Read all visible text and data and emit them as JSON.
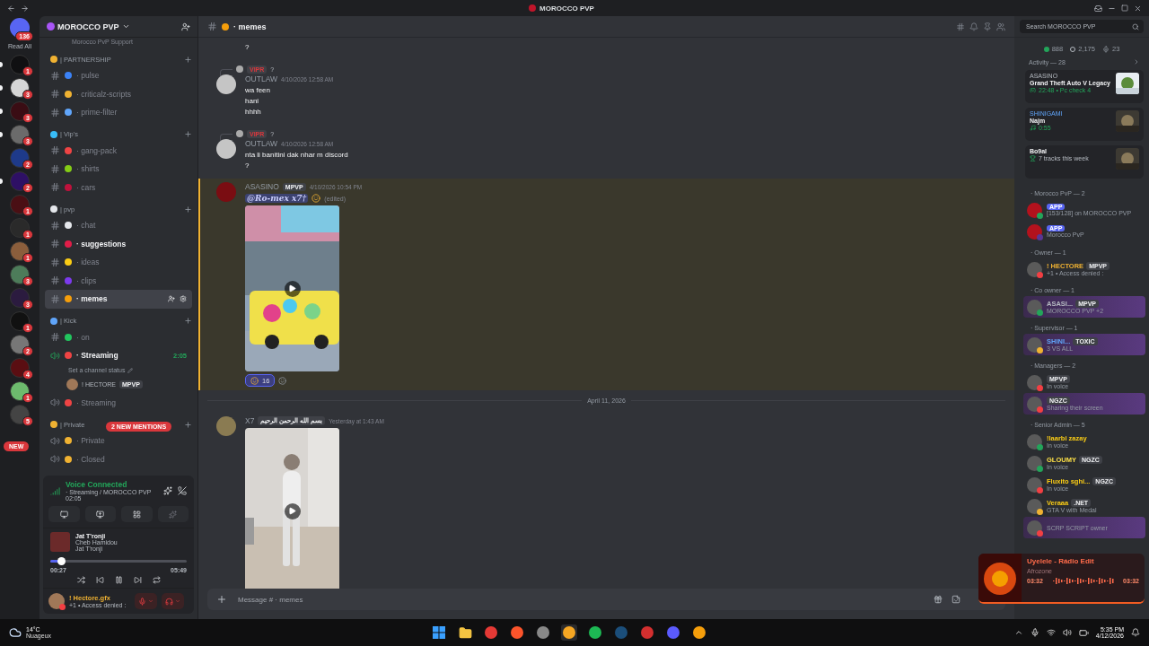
{
  "window": {
    "title": "MOROCCO PVP"
  },
  "rail": {
    "home_badge": "136",
    "read_all": "Read All",
    "new_pill": "NEW",
    "servers": [
      {
        "badge": "1",
        "unread": true
      },
      {
        "badge": "3",
        "unread": true
      },
      {
        "badge": "3",
        "unread": true
      },
      {
        "badge": "3",
        "unread": true
      },
      {
        "badge": "2",
        "unread": false
      },
      {
        "badge": "2",
        "unread": true
      },
      {
        "badge": "1",
        "unread": false
      },
      {
        "badge": "1",
        "unread": false
      },
      {
        "badge": "1",
        "unread": false
      },
      {
        "badge": "3",
        "unread": false
      },
      {
        "badge": "3",
        "unread": false
      },
      {
        "badge": "1",
        "unread": false
      },
      {
        "badge": "2",
        "unread": false
      },
      {
        "badge": "4",
        "unread": false
      },
      {
        "badge": "1",
        "unread": false
      },
      {
        "badge": "5",
        "unread": false
      }
    ]
  },
  "server": {
    "name": "MOROCCO PVP",
    "partial_item": "Morocco PvP Support",
    "mentions_pill": "2 NEW MENTIONS"
  },
  "categories": [
    {
      "name": "| PARTNERSHIP",
      "color": "#f0b232",
      "channels": [
        {
          "kind": "text",
          "name": "· pulse",
          "color": "#3b82f6",
          "selected": false,
          "unread": false
        },
        {
          "kind": "text",
          "name": "· criticalz-scripts",
          "color": "#f0b232",
          "selected": false,
          "unread": false
        },
        {
          "kind": "text",
          "name": "· prime-filter",
          "color": "#60a5fa",
          "selected": false,
          "unread": false
        }
      ]
    },
    {
      "name": "| Vip's",
      "color": "#38bdf8",
      "channels": [
        {
          "kind": "text",
          "name": "· gang-pack",
          "color": "#ef4444",
          "selected": false,
          "unread": false
        },
        {
          "kind": "text",
          "name": "· shirts",
          "color": "#84cc16",
          "selected": false,
          "unread": false
        },
        {
          "kind": "text",
          "name": "· cars",
          "color": "#be123c",
          "selected": false,
          "unread": false
        }
      ]
    },
    {
      "name": "| pvp",
      "color": "#e5e7eb",
      "channels": [
        {
          "kind": "text",
          "name": "· chat",
          "color": "#e5e7eb",
          "selected": false,
          "unread": false
        },
        {
          "kind": "text",
          "name": "· suggestions",
          "color": "#e11d48",
          "selected": false,
          "unread": true
        },
        {
          "kind": "text",
          "name": "· ideas",
          "color": "#facc15",
          "selected": false,
          "unread": false
        },
        {
          "kind": "text",
          "name": "· clips",
          "color": "#7c3aed",
          "selected": false,
          "unread": false
        },
        {
          "kind": "text",
          "name": "· memes",
          "color": "#f59e0b",
          "selected": true,
          "unread": false
        }
      ]
    },
    {
      "name": "| Kick",
      "color": "#60a5fa",
      "channels": [
        {
          "kind": "text",
          "name": "· on",
          "color": "#22c55e",
          "selected": false,
          "unread": false
        },
        {
          "kind": "voice",
          "name": "· Streaming",
          "color": "#ef4444",
          "selected": false,
          "unread": false,
          "active": true,
          "timer": "2:05",
          "status": "Set a channel status",
          "users": [
            {
              "name": "! HECTORE",
              "tag": "MPVP"
            }
          ]
        },
        {
          "kind": "voice",
          "name": "· Streaming",
          "color": "#ef4444",
          "selected": false,
          "unread": false,
          "active": false
        }
      ]
    },
    {
      "name": "| Private",
      "color": "#f0b232",
      "channels": [
        {
          "kind": "voice",
          "name": "· Private",
          "color": "#f0b232",
          "selected": false,
          "unread": false,
          "active": false
        },
        {
          "kind": "voice",
          "name": "· Closed",
          "color": "#f0b232",
          "selected": false,
          "unread": false,
          "active": false
        }
      ]
    }
  ],
  "voice": {
    "title": "Voice Connected",
    "channel": "· Streaming / MOROCCO PVP",
    "elapsed": "02:05"
  },
  "music": {
    "title": "Jat T'ronji",
    "artist": "Cheb Hamidou",
    "album": "Jat T'ronji",
    "level": 0.08,
    "position": "00:27",
    "duration": "05:49",
    "playing": true
  },
  "user": {
    "name": "! Hectore.gfx",
    "status": "+1 • Access denied :",
    "muted": true,
    "deafened": true
  },
  "channel": {
    "name": "· memes",
    "placeholder": "Search MOROCCO PVP"
  },
  "messages": [
    {
      "kind": "tail",
      "lines": [
        "?"
      ]
    },
    {
      "kind": "message",
      "reply": {
        "tag": "VIPR",
        "text": "?"
      },
      "author": "OUTLAW",
      "time": "4/10/2026 12:58 AM",
      "lines": [
        "wa feen",
        "hani",
        "hhhh"
      ],
      "highlighted": false
    },
    {
      "kind": "message",
      "reply": {
        "tag": "VIPR",
        "text": "?"
      },
      "author": "OUTLAW",
      "time": "4/10/2026 12:58 AM",
      "lines": [
        "nta li banitini dak nhar m discord",
        "?"
      ],
      "highlighted": false
    },
    {
      "kind": "message",
      "author": "ASASINO",
      "tag": "MPVP",
      "time": "4/10/2026 10:54 PM",
      "mention": "@Ro-mex x7†",
      "edited": "(edited)",
      "highlighted": true,
      "video": true,
      "reaction": {
        "count": "16",
        "reacted": true
      }
    },
    {
      "kind": "divider",
      "label": "April 11, 2026"
    },
    {
      "kind": "message",
      "author": "X7",
      "tag": "بسم الله الرحمن الرحيم",
      "time": "Yesterday at 1:43 AM",
      "highlighted": false,
      "video": true
    }
  ],
  "composer": {
    "placeholder": "Message # · memes"
  },
  "stats": {
    "online": "888",
    "members": "2,175",
    "voice": "23"
  },
  "activity": {
    "title": "Activity — 28",
    "cards": [
      {
        "kind": "game",
        "user": "ASASINO",
        "title": "Grand Theft Auto V Legacy",
        "detail": "22:48 • Pc check 4"
      },
      {
        "kind": "music",
        "user": "SHINIGAMI",
        "title": "Najm",
        "detail": "0:55"
      },
      {
        "kind": "trophy",
        "title": "Bo9al",
        "detail": "7 tracks this week"
      }
    ]
  },
  "groups": [
    {
      "title": "· Morocco PvP — 2",
      "members": [
        {
          "badge": "APP",
          "sub": "[153/128] on MOROCCO PVP",
          "color": "#23a55a",
          "nameplate": false
        },
        {
          "badge": "APP",
          "sub": "Morocco PvP",
          "color": "#593695",
          "nameplate": false
        }
      ]
    },
    {
      "title": "· Owner — 1",
      "members": [
        {
          "name": {
            "text": "! HECTORE",
            "color": "#f0b232"
          },
          "tag": "MPVP",
          "sub": "+1 • Access denied :",
          "color": "#f23f43",
          "nameplate": false
        }
      ]
    },
    {
      "title": "· Co owner — 1",
      "members": [
        {
          "name": {
            "text": "ASASI...",
            "color": "#b5bac1"
          },
          "tag": "MPVP",
          "sub": "MOROCCO PVP +2",
          "color": "#23a55a",
          "nameplate": true
        }
      ]
    },
    {
      "title": "· Supervisor — 1",
      "members": [
        {
          "name": {
            "text": "SHINI...",
            "color": "#60a5fa"
          },
          "tag": "TOXIC",
          "sub": "3 VS ALL",
          "color": "#f0b232",
          "nameplate": true
        }
      ]
    },
    {
      "title": "· Managers — 2",
      "members": [
        {
          "tag": "MPVP",
          "sub": "In voice",
          "color": "#f23f43",
          "nameplate": false
        },
        {
          "tag": "NGZC",
          "sub": "Sharing their screen",
          "color": "#f23f43",
          "nameplate": true
        }
      ]
    },
    {
      "title": "· Senior Admin — 5",
      "members": [
        {
          "name": {
            "text": "!laarbi zazay",
            "color": "#facc15"
          },
          "sub": "In voice",
          "color": "#23a55a",
          "nameplate": false
        },
        {
          "name": {
            "text": "GLOUMY",
            "color": "#fde047"
          },
          "tag": "NGZC",
          "sub": "In voice",
          "color": "#23a55a",
          "nameplate": false
        },
        {
          "name": {
            "text": "Fluxito sghi...",
            "color": "#facc15"
          },
          "tag": "NGZC",
          "sub": "In voice",
          "color": "#f23f43",
          "nameplate": false
        },
        {
          "name": {
            "text": "Veraaa",
            "color": "#facc15"
          },
          "tag": ".NET",
          "sub": "GTA V with Medal",
          "color": "#f0b232",
          "nameplate": false
        },
        {
          "sub": "SCRP SCRIPT owner",
          "color": "#f23f43",
          "nameplate": true
        }
      ]
    }
  ],
  "now_playing": {
    "title": "Uyelele - Rádio Edit",
    "artist": "Afrozone",
    "position": "03:32",
    "duration": "03:32"
  },
  "taskbar": {
    "temperature": "14°C",
    "weather": "Nuageux",
    "time": "5:35 PM",
    "date": "4/12/2026"
  }
}
